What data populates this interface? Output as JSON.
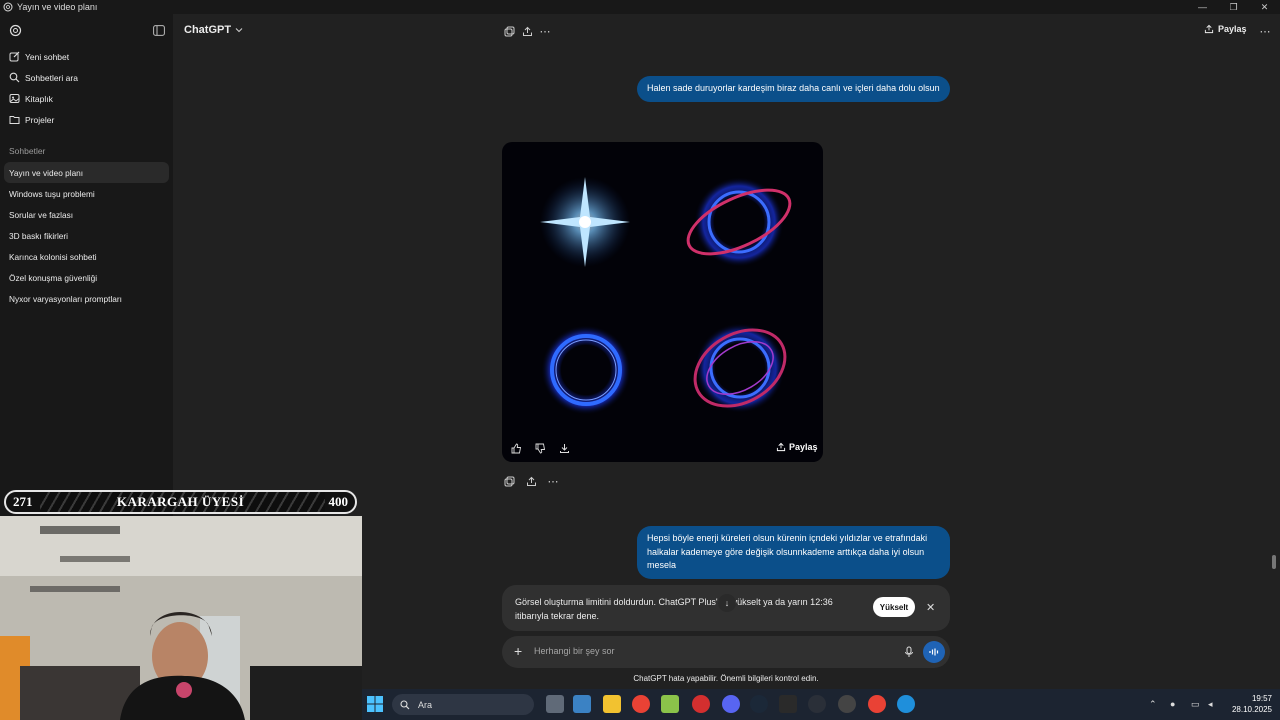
{
  "window": {
    "title": "Yayın ve video planı"
  },
  "sidebar": {
    "menu": [
      {
        "label": "Yeni sohbet",
        "icon": "new-chat-icon"
      },
      {
        "label": "Sohbetleri ara",
        "icon": "search-icon"
      },
      {
        "label": "Kitaplık",
        "icon": "library-icon"
      },
      {
        "label": "Projeler",
        "icon": "projects-icon"
      }
    ],
    "section_title": "Sohbetler",
    "chats": [
      "Yayın ve video planı",
      "Windows tuşu problemi",
      "Sorular ve fazlası",
      "3D baskı fikirleri",
      "Karınca kolonisi sohbeti",
      "Özel konuşma güvenliği",
      "Nyxor varyasyonları promptları"
    ]
  },
  "header": {
    "model": "ChatGPT",
    "share_label": "Paylaş"
  },
  "messages": {
    "user1": "Halen sade duruyorlar kardeşim biraz daha canlı ve içleri daha dolu olsun",
    "image_share": "Paylaş",
    "user2": "Hepsi böyle enerji küreleri olsun kürenin içndeki yıldızlar ve etrafındaki halkalar kademeye göre değişik olsunnkademe arttıkça daha iyi olsun mesela"
  },
  "limit_notice": {
    "text": "Görsel oluşturma limitini doldurdun. ChatGPT Plus'ına yükselt ya da yarın 12:36 itibarıyla tekrar dene.",
    "upgrade_label": "Yükselt"
  },
  "composer": {
    "placeholder": "Herhangi bir şey sor"
  },
  "disclaimer": "ChatGPT hata yapabilir. Önemli bilgileri kontrol edin.",
  "overlay": {
    "left_number": "271",
    "label": "KARARGAH ÜYESİ",
    "right_number": "400"
  },
  "taskbar": {
    "search_label": "Ara",
    "time": "19:57",
    "date": "28.10.2025",
    "apps": [
      "explorer-icon",
      "store-icon",
      "files-icon",
      "chrome-icon",
      "app-icon",
      "app-red-icon",
      "discord-icon",
      "steam-icon",
      "epic-icon",
      "chatgpt-icon",
      "obs-icon",
      "chrome-icon",
      "edge-icon"
    ]
  },
  "colors": {
    "accent": "#0b4f8a",
    "background": "#212121",
    "sidebar": "#181818"
  }
}
